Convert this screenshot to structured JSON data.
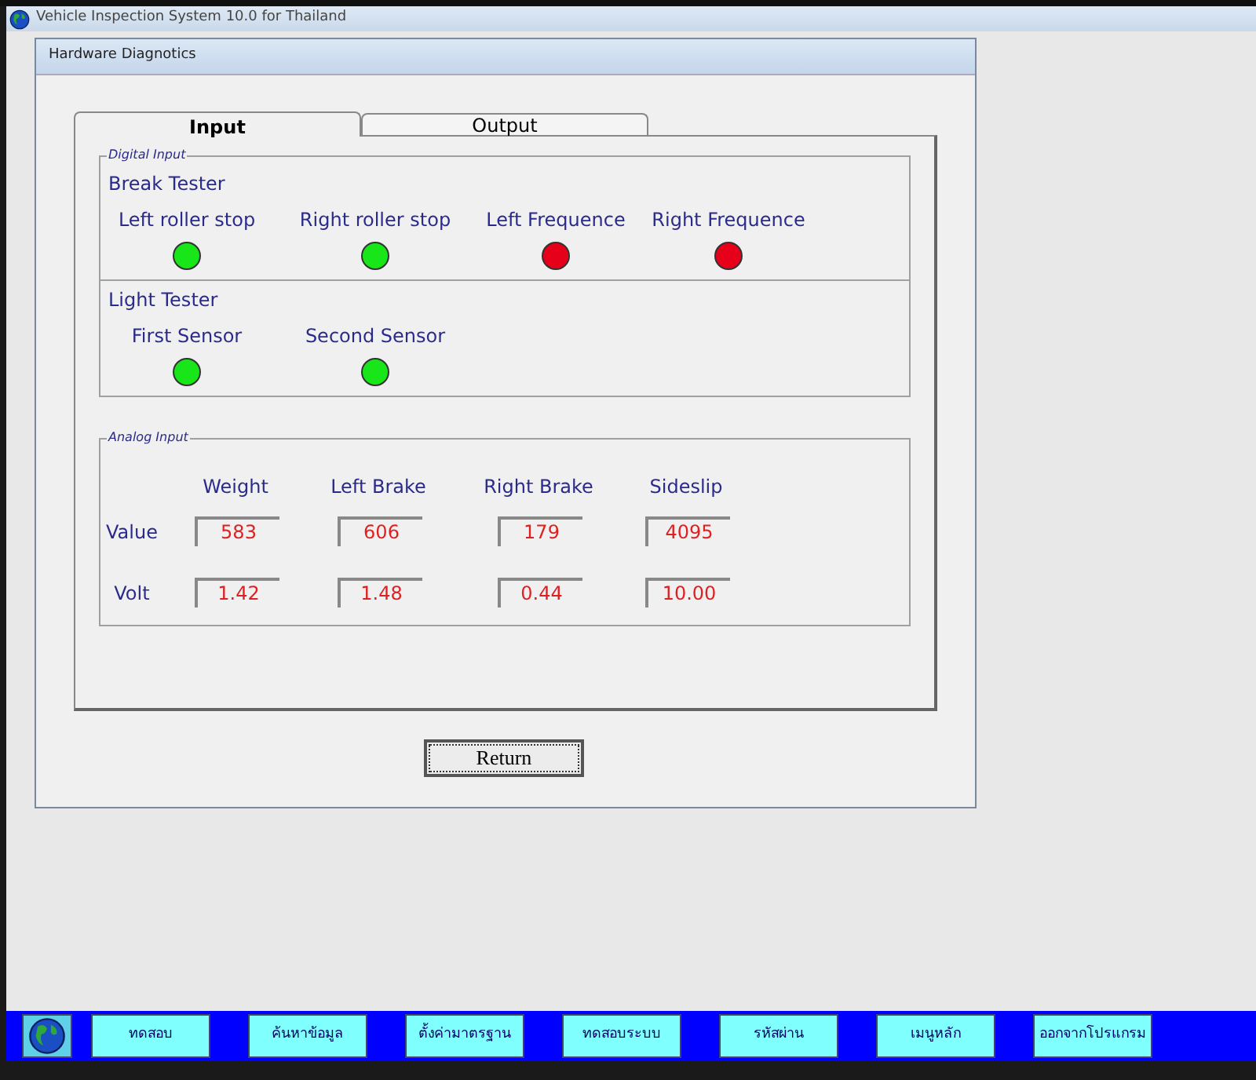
{
  "window": {
    "title": "Vehicle Inspection System 10.0 for Thailand"
  },
  "dialog": {
    "title": "Hardware Diagnotics"
  },
  "tabs": [
    {
      "label": "Input",
      "selected": true
    },
    {
      "label": "Output",
      "selected": false
    }
  ],
  "digital_input": {
    "legend": "Digital Input",
    "groups": [
      {
        "title": "Break Tester",
        "signals": [
          {
            "label": "Left roller stop",
            "on": true
          },
          {
            "label": "Right roller stop",
            "on": true
          },
          {
            "label": "Left Frequence",
            "on": false
          },
          {
            "label": "Right Frequence",
            "on": false
          }
        ]
      },
      {
        "title": "Light Tester",
        "signals": [
          {
            "label": "First Sensor",
            "on": true
          },
          {
            "label": "Second Sensor",
            "on": true
          }
        ]
      }
    ]
  },
  "analog_input": {
    "legend": "Analog Input",
    "columns": [
      "Weight",
      "Left Brake",
      "Right Brake",
      "Sideslip"
    ],
    "rows": [
      {
        "label": "Value",
        "cells": [
          "583",
          "606",
          "179",
          "4095"
        ]
      },
      {
        "label": "Volt",
        "cells": [
          "1.42",
          "1.48",
          "0.44",
          "10.00"
        ]
      }
    ]
  },
  "return_button": "Return",
  "taskbar": [
    "ทดสอบ",
    "ค้นหาข้อมูล",
    "ตั้งค่ามาตรฐาน",
    "ทดสอบระบบ",
    "รหัสผ่าน",
    "เมนูหลัก",
    "ออกจากโปรแกรม"
  ]
}
